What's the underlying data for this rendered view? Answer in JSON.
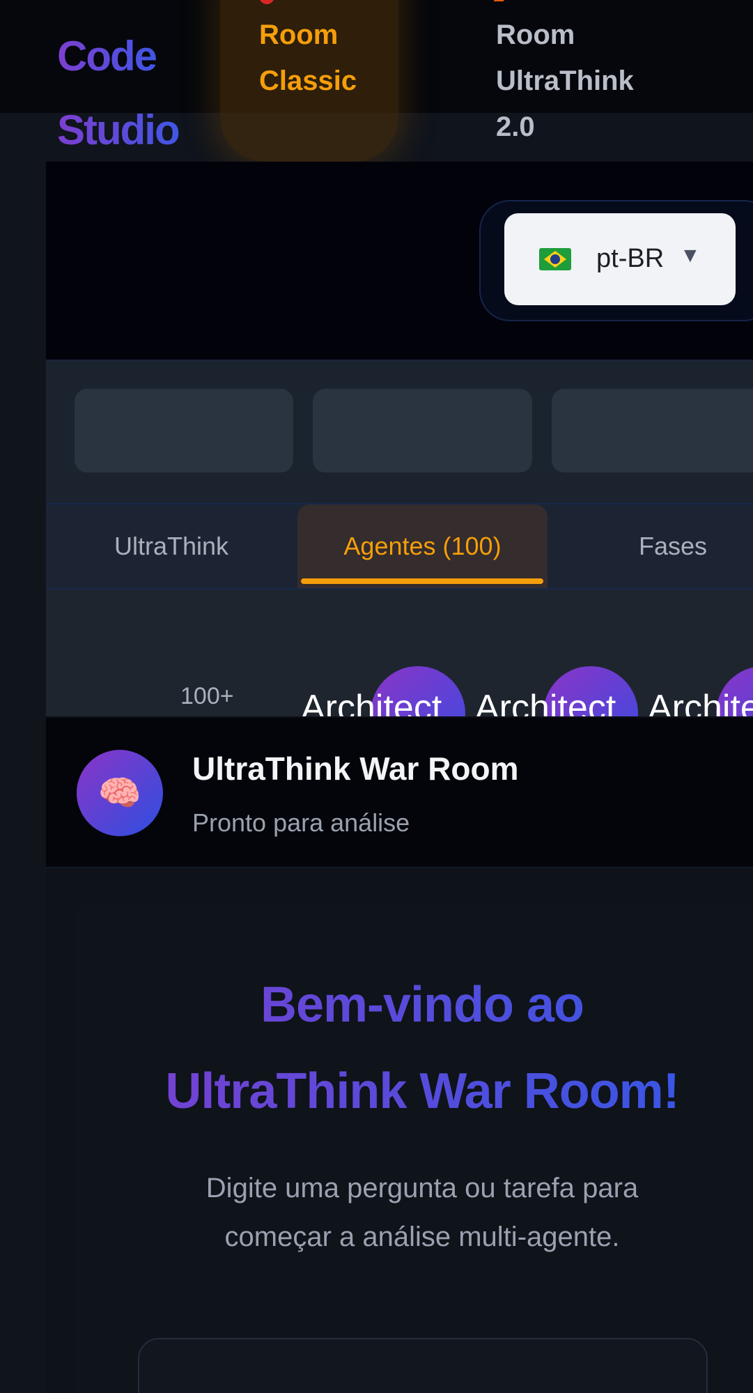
{
  "header": {
    "brand_line_1": "Code",
    "brand_line_2": "Studio",
    "classic_line_1": "Room",
    "classic_line_2": "Classic",
    "mode_line_1": "Room",
    "mode_line_2": "UltraThink",
    "mode_line_3": "2.0"
  },
  "language": {
    "selected": "pt-BR",
    "caret": "▼"
  },
  "tabs": [
    {
      "label": "UltraThink"
    },
    {
      "label": "Agentes (100)"
    },
    {
      "label": "Fases"
    }
  ],
  "agents": {
    "count_label": "100+",
    "items": [
      {
        "label": "Architect"
      },
      {
        "label": "Architect"
      },
      {
        "label": "Architect"
      }
    ]
  },
  "chat": {
    "avatar_emoji": "🧠",
    "title": "UltraThink War Room",
    "status": "Pronto para análise"
  },
  "welcome": {
    "title_line_1": "Bem-vindo ao",
    "title_line_2": "UltraThink War Room!",
    "subtitle_line_1": "Digite uma pergunta ou tarefa para",
    "subtitle_line_2": "começar a análise multi-agente."
  },
  "colors": {
    "accent": "#f59e0b",
    "brand_start": "#7d3fd0",
    "brand_end": "#3f56e4"
  }
}
